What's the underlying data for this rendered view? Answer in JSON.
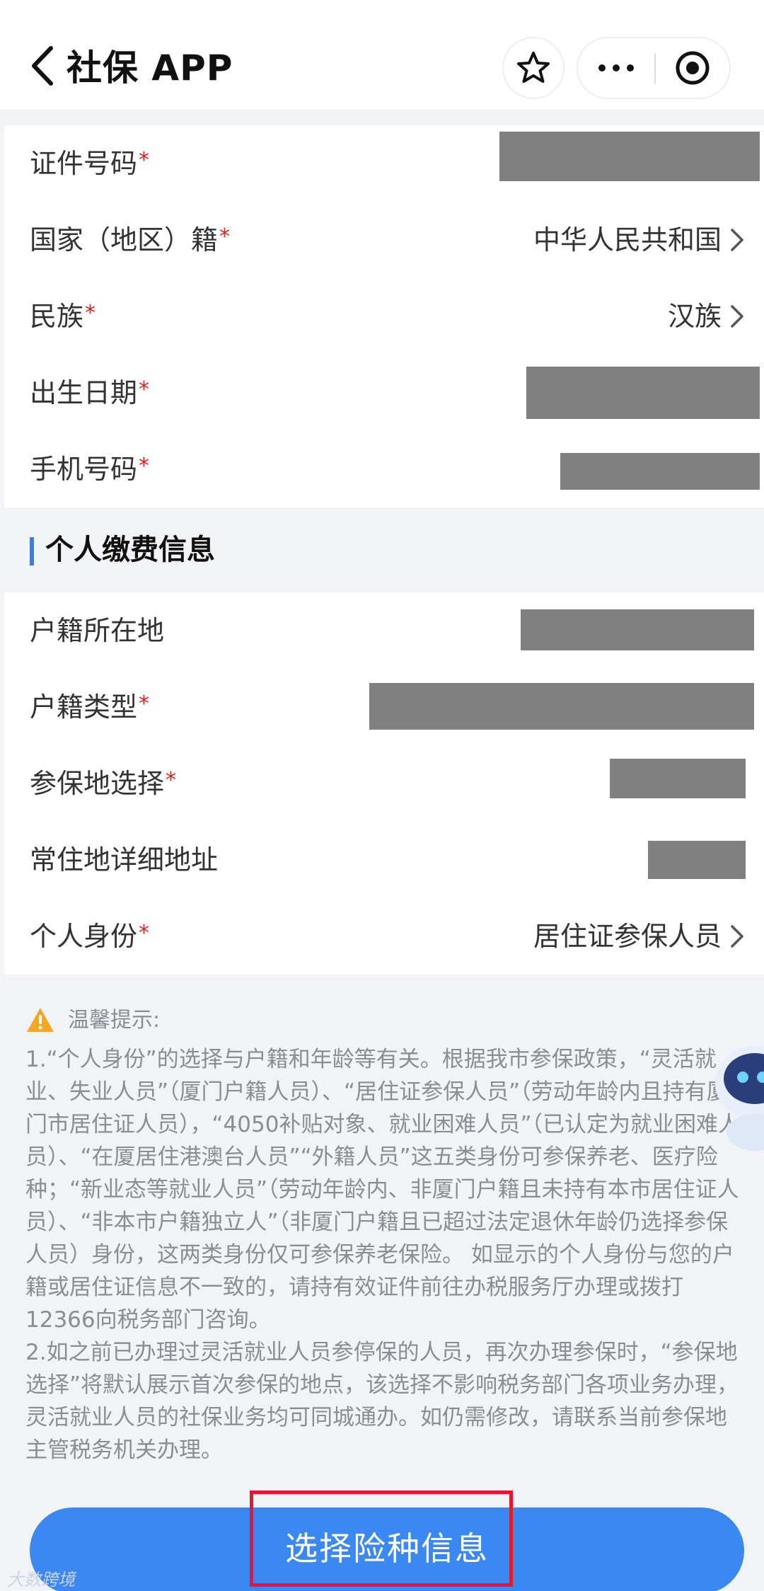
{
  "header": {
    "title": "社保 APP"
  },
  "identity": {
    "rows": [
      {
        "label": "证件号码",
        "required": "*",
        "value": ""
      },
      {
        "label": "国家（地区）籍",
        "required": "*",
        "value": "中华人民共和国"
      },
      {
        "label": "民族",
        "required": "*",
        "value": "汉族"
      },
      {
        "label": "出生日期",
        "required": "*",
        "value": ""
      },
      {
        "label": "手机号码",
        "required": "*",
        "value": ""
      }
    ]
  },
  "payment_section": {
    "title": "个人缴费信息",
    "rows": [
      {
        "label": "户籍所在地",
        "required": "",
        "value": ""
      },
      {
        "label": "户籍类型",
        "required": "*",
        "value": ""
      },
      {
        "label": "参保地选择",
        "required": "*",
        "value": ""
      },
      {
        "label": "常住地详细地址",
        "required": "",
        "value": ""
      },
      {
        "label": "个人身份",
        "required": "*",
        "value": "居住证参保人员"
      }
    ]
  },
  "tips": {
    "title": "温馨提示:",
    "paragraph_1": "1.“个人身份”的选择与户籍和年龄等有关。根据我市参保政策，“灵活就业、失业人员”（厦门户籍人员）、“居住证参保人员”（劳动年龄内且持有厦门市居住证人员），“4050补贴对象、就业困难人员”（已认定为就业困难人员）、“在厦居住港澳台人员”“外籍人员”这五类身份可参保养老、医疗险种；“新业态等就业人员”（劳动年龄内、非厦门户籍且未持有本市居住证人员）、“非本市户籍独立人”（非厦门户籍且已超过法定退休年龄仍选择参保人员）身份，这两类身份仅可参保养老保险。 如显示的个人身份与您的户籍或居住证信息不一致的，请持有效证件前往办税服务厅办理或拨打12366向税务部门咨询。",
    "paragraph_2": "2.如之前已办理过灵活就业人员参停保的人员，再次办理参保时，“参保地选择”将默认展示首次参保的地点，该选择不影响税务部门各项业务办理，灵活就业人员的社保业务均可同城通办。如仍需修改，请联系当前参保地主管税务机关办理。"
  },
  "footer": {
    "submit_label": "选择险种信息",
    "watermark": "大数跨境"
  },
  "colors": {
    "accent": "#3b88f2",
    "required": "#e02020",
    "highlight": "#e2192f",
    "redaction": "#808080"
  }
}
